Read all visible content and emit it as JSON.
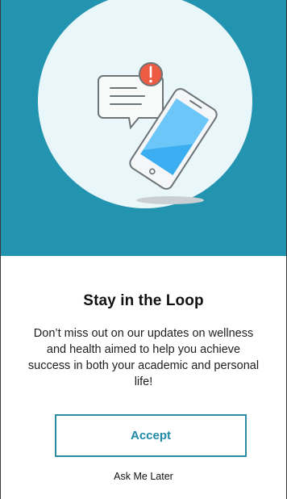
{
  "hero": {
    "background_color": "#2294b0",
    "illustration": "notification-phone-illustration",
    "icons": [
      "message-bubble-icon",
      "alert-badge-icon",
      "smartphone-icon"
    ]
  },
  "content": {
    "title": "Stay in the Loop",
    "body": "Don’t miss out on our updates on wellness and health aimed to help you achieve success in both your academic and personal life!"
  },
  "actions": {
    "accept_label": "Accept",
    "later_label": "Ask Me Later",
    "accent_color": "#2a8ca5"
  }
}
